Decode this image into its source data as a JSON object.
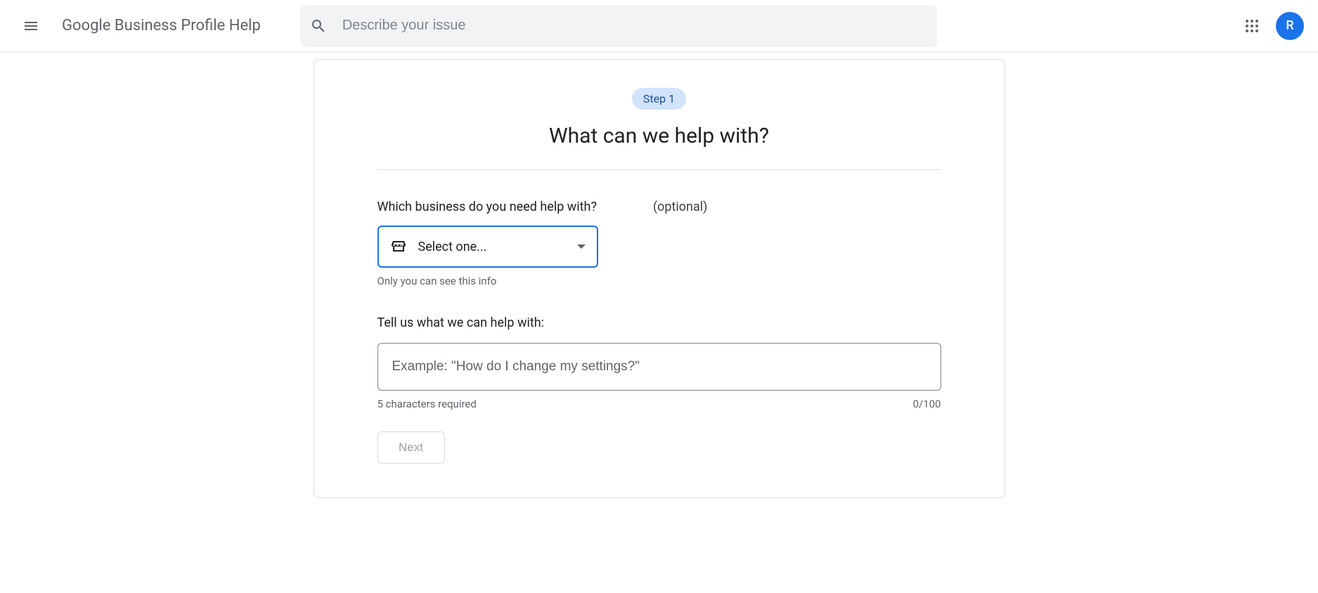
{
  "header": {
    "title": "Google Business Profile Help",
    "search_placeholder": "Describe your issue",
    "avatar_letter": "R"
  },
  "card": {
    "step_badge": "Step 1",
    "title": "What can we help with?",
    "business_label": "Which business do you need help with?",
    "optional_label": "(optional)",
    "select_value": "Select one...",
    "privacy_hint": "Only you can see this info",
    "issue_label": "Tell us what we can help with:",
    "issue_placeholder": "Example: \"How do I change my settings?\"",
    "min_chars_hint": "5 characters required",
    "char_count": "0/100",
    "next_label": "Next"
  }
}
